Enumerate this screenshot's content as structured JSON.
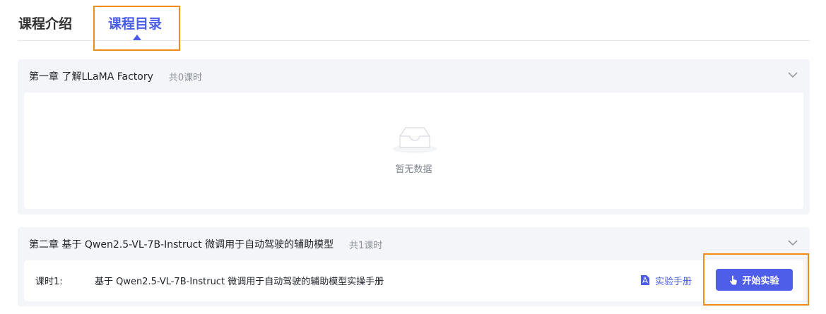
{
  "tabs": {
    "intro_label": "课程介绍",
    "catalog_label": "课程目录",
    "active": "catalog"
  },
  "chapters": [
    {
      "title": "第一章 了解LLaMA Factory",
      "count": "共0课时",
      "empty_text": "暂无数据"
    },
    {
      "title": "第二章 基于 Qwen2.5-VL-7B-Instruct 微调用于自动驾驶的辅助模型",
      "count": "共1课时",
      "lessons": [
        {
          "label": "课时1:",
          "title": "基于 Qwen2.5-VL-7B-Instruct 微调用于自动驾驶的辅助模型实操手册",
          "manual_label": "实验手册",
          "start_label": "开始实验"
        }
      ]
    }
  ],
  "colors": {
    "accent": "#4a5ce8",
    "highlight": "#f08c1a",
    "chapter_bg": "#f4f5f8"
  },
  "icons": {
    "chapter_toggle": "chevron-down-icon",
    "empty": "empty-inbox-icon",
    "manual": "pdf-file-icon",
    "start": "hand-pointer-icon"
  }
}
